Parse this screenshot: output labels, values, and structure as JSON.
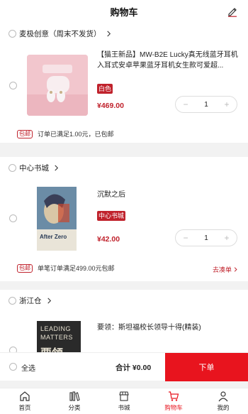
{
  "header": {
    "title": "购物车"
  },
  "stores": [
    {
      "name": "麦极创意（周末不发货）",
      "items": [
        {
          "title": "【猫王新品】MW-B2E Lucky真无线蓝牙耳机 入耳式安卓苹果蓝牙耳机女生款可爱超...",
          "tag": "白色",
          "price": "¥469.00",
          "qty": "1"
        }
      ],
      "promo": {
        "badge": "包邮",
        "text": "订单已满足1.00元，已包邮",
        "link": ""
      }
    },
    {
      "name": "中心书城",
      "items": [
        {
          "title": "沉默之后",
          "tag": "中心书城",
          "price": "¥42.00",
          "qty": "1",
          "cover_text": "After Zero"
        }
      ],
      "promo": {
        "badge": "包邮",
        "text": "单笔订单满足499.00元包邮",
        "link": "去凑单"
      }
    },
    {
      "name": "浙江仓",
      "items": [
        {
          "title": "要领：斯坦福校长领导十得(精装)",
          "cover_text_1": "LEADING",
          "cover_text_2": "MATTERS",
          "cover_text_3": "要领"
        }
      ]
    }
  ],
  "checkout": {
    "select_all": "全选",
    "total": "合计 ¥0.00",
    "button": "下单"
  },
  "tabbar": [
    {
      "label": "首页",
      "icon": "home-icon"
    },
    {
      "label": "分类",
      "icon": "category-icon"
    },
    {
      "label": "书城",
      "icon": "store-icon"
    },
    {
      "label": "购物车",
      "icon": "cart-icon",
      "active": true
    },
    {
      "label": "我的",
      "icon": "profile-icon"
    }
  ],
  "colors": {
    "accent": "#e8141e",
    "price": "#c0222c"
  }
}
